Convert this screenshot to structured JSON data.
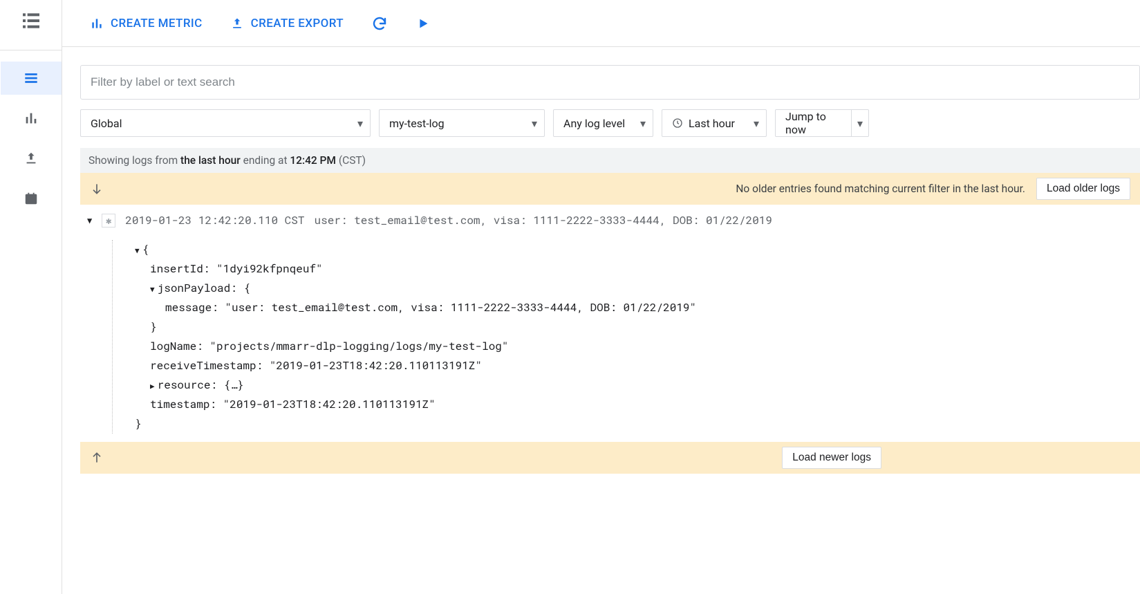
{
  "toolbar": {
    "create_metric": "CREATE METRIC",
    "create_export": "CREATE EXPORT"
  },
  "filter": {
    "placeholder": "Filter by label or text search",
    "resource": "Global",
    "log_name": "my-test-log",
    "log_level": "Any log level",
    "time_range": "Last hour",
    "jump": "Jump to now"
  },
  "status": {
    "prefix": "Showing logs from ",
    "range_bold": "the last hour",
    "mid": " ending at ",
    "time_bold": "12:42 PM",
    "tz": " (CST)"
  },
  "older_bar": {
    "message": "No older entries found matching current filter in the last hour.",
    "button": "Load older logs"
  },
  "log": {
    "timestamp": "2019-01-23 12:42:20.110 CST",
    "summary": "user: test_email@test.com, visa: 1111-2222-3333-4444, DOB: 01/22/2019",
    "open_brace": "{",
    "insertId_k": "insertId: ",
    "insertId_v": "\"1dyi92kfpnqeuf\"",
    "jsonPayload_k": "jsonPayload: ",
    "jsonPayload_open": "{",
    "message_k": "message: ",
    "message_v": "\"user: test_email@test.com, visa: 1111-2222-3333-4444, DOB: 01/22/2019\"",
    "jp_close": "}",
    "logName_k": "logName: ",
    "logName_v": "\"projects/mmarr-dlp-logging/logs/my-test-log\"",
    "recvTs_k": "receiveTimestamp: ",
    "recvTs_v": "\"2019-01-23T18:42:20.110113191Z\"",
    "resource_k": "resource: ",
    "resource_v": "{…}",
    "ts_k": "timestamp: ",
    "ts_v": "\"2019-01-23T18:42:20.110113191Z\"",
    "close_brace": "}"
  },
  "newer_bar": {
    "button": "Load newer logs"
  }
}
